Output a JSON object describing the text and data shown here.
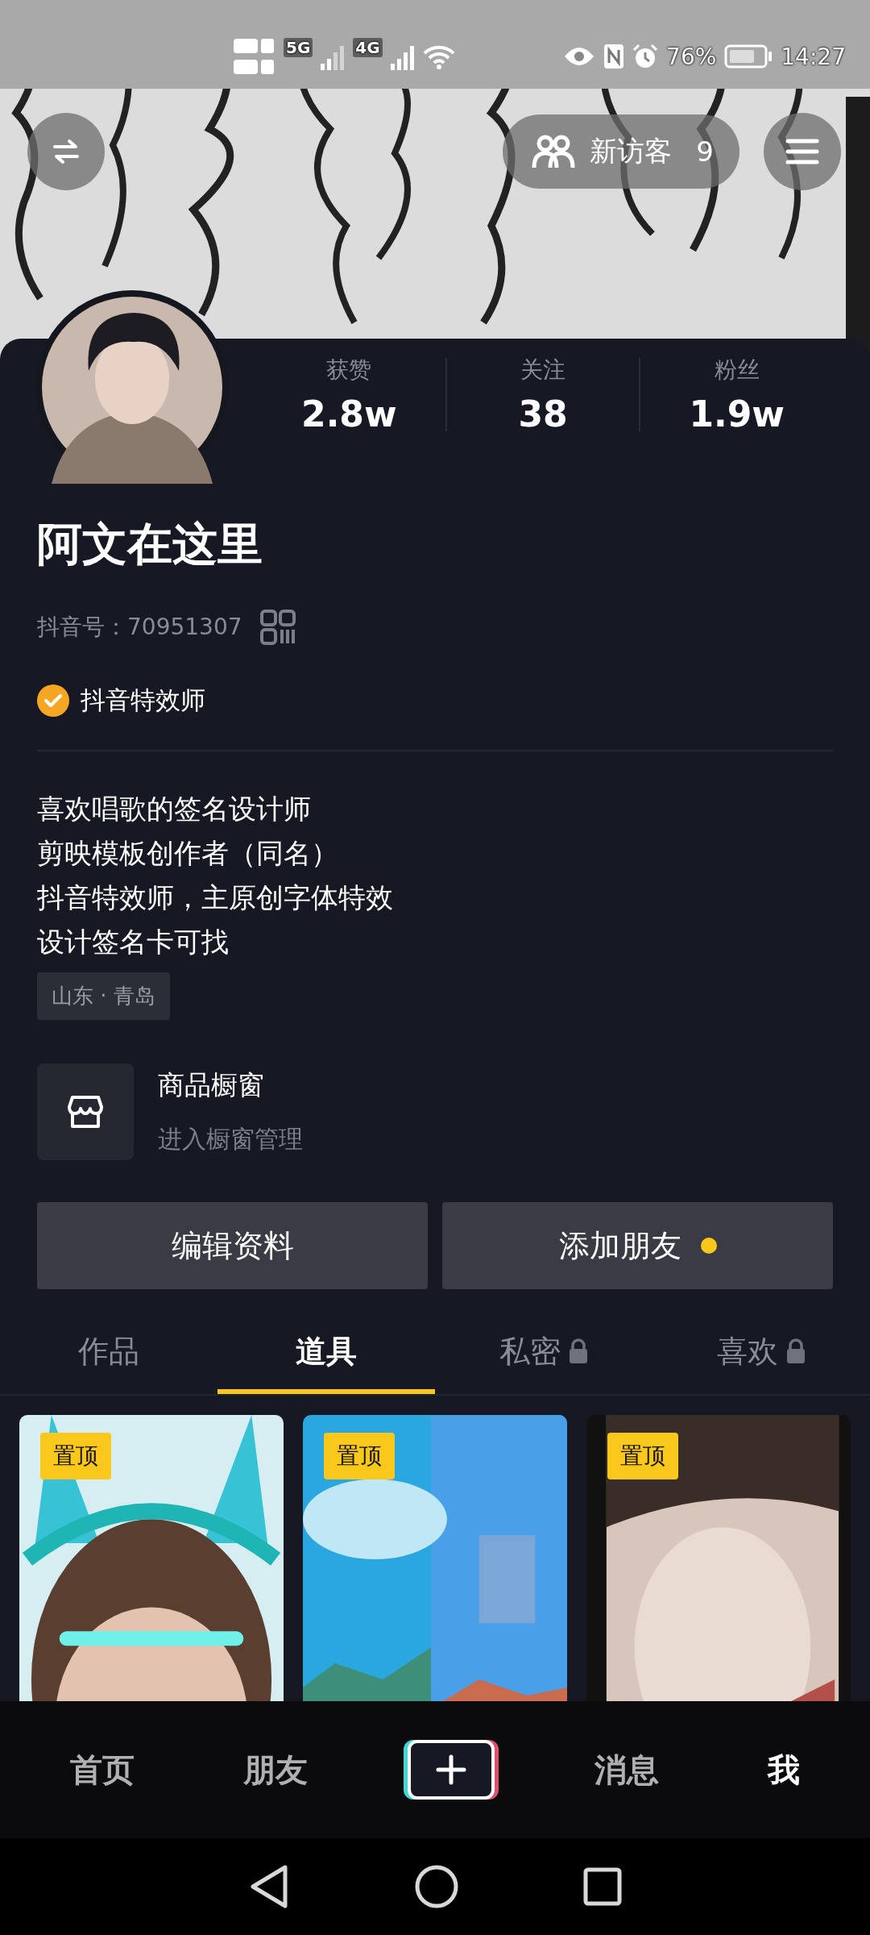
{
  "status_bar": {
    "network_1": "5G",
    "network_2": "4G",
    "battery": "76%",
    "time": "14:27"
  },
  "header": {
    "visitors": {
      "label": "新访客",
      "count": "9"
    }
  },
  "stats": [
    {
      "label": "获赞",
      "value": "2.8w"
    },
    {
      "label": "关注",
      "value": "38"
    },
    {
      "label": "粉丝",
      "value": "1.9w"
    }
  ],
  "profile": {
    "name": "阿文在这里",
    "id": "抖音号：70951307",
    "badge": "抖音特效师",
    "bio": [
      "喜欢唱歌的签名设计师",
      "剪映模板创作者（同名）",
      "抖音特效师，主原创字体特效",
      "设计签名卡可找"
    ],
    "location": "山东 · 青岛"
  },
  "shop": {
    "title": "商品橱窗",
    "subtitle": "进入橱窗管理"
  },
  "buttons": [
    {
      "label": "编辑资料",
      "dot": false
    },
    {
      "label": "添加朋友",
      "dot": true
    }
  ],
  "tabs": [
    {
      "label": "作品",
      "selected": false,
      "locked": false
    },
    {
      "label": "道具",
      "selected": true,
      "locked": false
    },
    {
      "label": "私密",
      "selected": false,
      "locked": true
    },
    {
      "label": "喜欢",
      "selected": false,
      "locked": true
    }
  ],
  "grid": [
    {
      "kind": "picture",
      "badge": "置顶"
    },
    {
      "kind": "picture",
      "badge": "置顶"
    },
    {
      "kind": "picture",
      "badge": "置顶"
    }
  ],
  "bottom_nav": [
    {
      "kind": "text",
      "label": "首页",
      "selected": false
    },
    {
      "kind": "text",
      "label": "朋友",
      "selected": false
    },
    {
      "kind": "create",
      "selected": false
    },
    {
      "kind": "text",
      "label": "消息",
      "selected": false
    },
    {
      "kind": "text",
      "label": "我",
      "selected": true
    }
  ]
}
